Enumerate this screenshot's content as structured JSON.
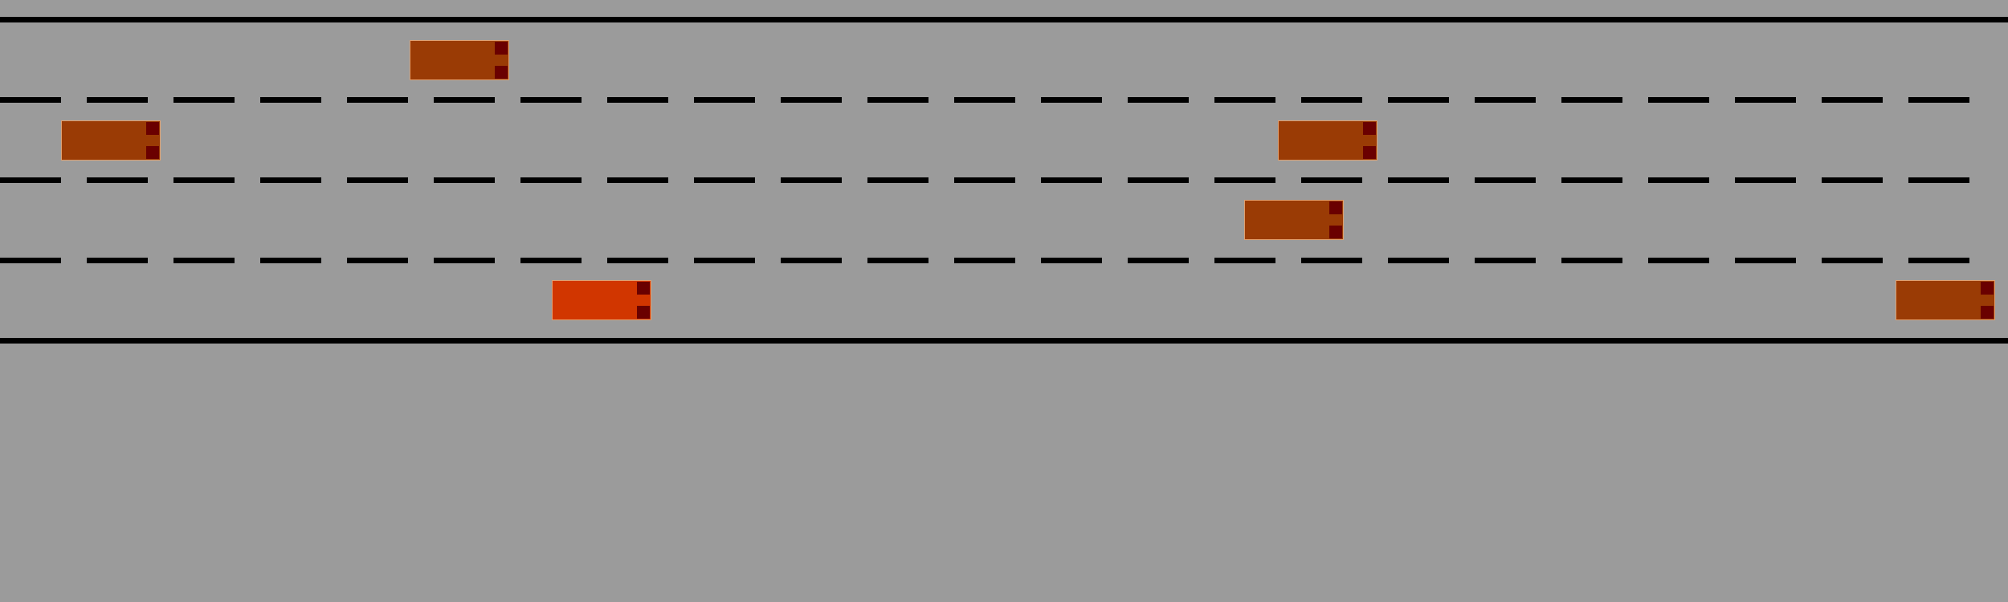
{
  "game": {
    "title": "",
    "lane_count": 4,
    "colors": {
      "road": "#9b9b9b",
      "line": "#000000",
      "npc_car": "#9a3b05",
      "ego_car": "#d13600",
      "tail_light": "#6a0000"
    },
    "vehicles": [
      {
        "role": "npc",
        "lane": 1,
        "color": "#9a3b05"
      },
      {
        "role": "npc",
        "lane": 2,
        "color": "#9a3b05"
      },
      {
        "role": "npc",
        "lane": 2,
        "color": "#9a3b05"
      },
      {
        "role": "npc",
        "lane": 3,
        "color": "#9a3b05"
      },
      {
        "role": "ego",
        "lane": 4,
        "color": "#d13600"
      },
      {
        "role": "npc",
        "lane": 4,
        "color": "#9a3b05"
      }
    ]
  }
}
